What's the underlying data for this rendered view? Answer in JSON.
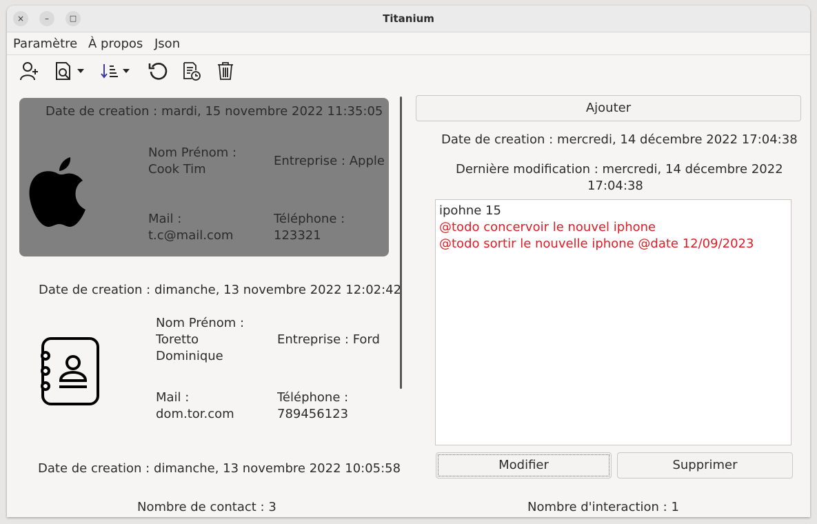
{
  "window": {
    "title": "Titanium",
    "close_label": "×",
    "minimize_label": "–",
    "maximize_label": "□"
  },
  "menu": [
    "Paramètre",
    "À propos",
    "Json"
  ],
  "toolbar": {
    "icons": [
      "add-user-icon",
      "search-document-icon",
      "sort-icon",
      "refresh-icon",
      "history-document-icon",
      "trash-icon"
    ]
  },
  "contacts": [
    {
      "date": "Date de creation : mardi, 15 novembre 2022 11:35:05",
      "name_label": "Nom Prénom :",
      "name": "Cook Tim",
      "company": "Entreprise : Apple",
      "mail_label": "Mail :",
      "mail": "t.c@mail.com",
      "phone_label": "Téléphone :",
      "phone": "123321",
      "selected": true,
      "icon": "apple-logo-icon"
    },
    {
      "date": "Date de creation : dimanche, 13 novembre 2022 12:02:42",
      "name_label": "Nom Prénom :",
      "name_line1": "Toretto",
      "name_line2": "Dominique",
      "company": "Entreprise : Ford",
      "mail_label": "Mail :",
      "mail": "dom.tor.com",
      "phone_label": "Téléphone :",
      "phone": "789456123",
      "icon": "contact-book-icon"
    },
    {
      "date": "Date de creation : dimanche, 13 novembre 2022 10:05:58"
    }
  ],
  "contact_count": "Nombre de contact : 3",
  "interaction": {
    "add_label": "Ajouter",
    "created": "Date de creation : mercredi, 14 décembre 2022 17:04:38",
    "modified_line1": "Dernière modification : mercredi, 14 décembre 2022",
    "modified_line2": "17:04:38",
    "notes": [
      "ipohne 15",
      "@todo concervoir le nouvel iphone",
      "@todo sortir le nouvelle iphone @date 12/09/2023"
    ],
    "modify_label": "Modifier",
    "delete_label": "Supprimer",
    "count": "Nombre d'interaction : 1",
    "todo_color": "#e01b24"
  }
}
